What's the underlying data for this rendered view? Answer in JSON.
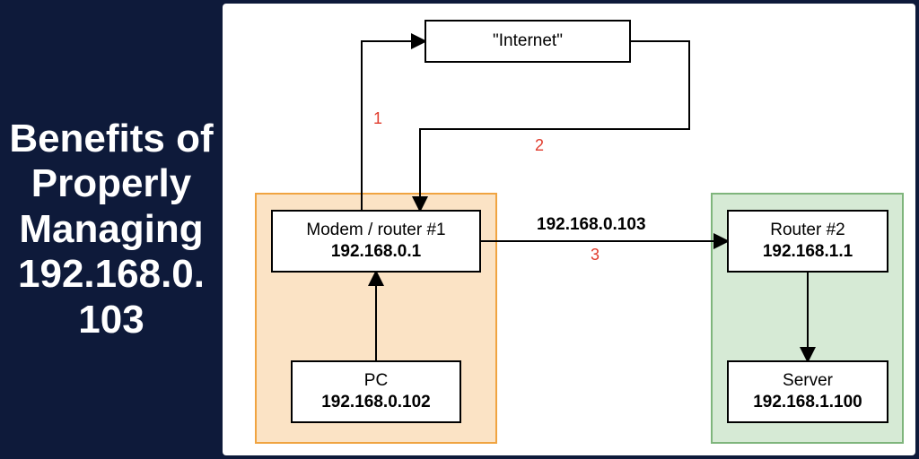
{
  "title": "Benefits of Properly Managing 192.168.0.103",
  "colors": {
    "bg": "#0e1a3a",
    "subnetA_fill": "#fbe3c5",
    "subnetA_border": "#f0a441",
    "subnetB_fill": "#d6ead5",
    "subnetB_border": "#7fb57c",
    "edge_number": "#e03b2c"
  },
  "nodes": {
    "internet": {
      "label": "\"Internet\""
    },
    "modem": {
      "label": "Modem / router #1",
      "ip": "192.168.0.1"
    },
    "pc": {
      "label": "PC",
      "ip": "192.168.0.102"
    },
    "router2": {
      "label": "Router #2",
      "ip": "192.168.1.1"
    },
    "server": {
      "label": "Server",
      "ip": "192.168.1.100"
    }
  },
  "edges": {
    "e1": {
      "num": "1",
      "from": "modem",
      "to": "internet",
      "desc": "Modem uplink to Internet"
    },
    "e2": {
      "num": "2",
      "from": "internet",
      "to": "modem",
      "desc": "Internet return path to Modem"
    },
    "e3": {
      "num": "3",
      "from": "modem",
      "to": "router2",
      "ip_label": "192.168.0.103",
      "desc": "Modem LAN to Router #2 WAN"
    },
    "pc_to_modem": {
      "from": "pc",
      "to": "modem",
      "desc": "PC to Modem"
    },
    "router2_to_server": {
      "from": "router2",
      "to": "server",
      "desc": "Router #2 to Server"
    }
  }
}
